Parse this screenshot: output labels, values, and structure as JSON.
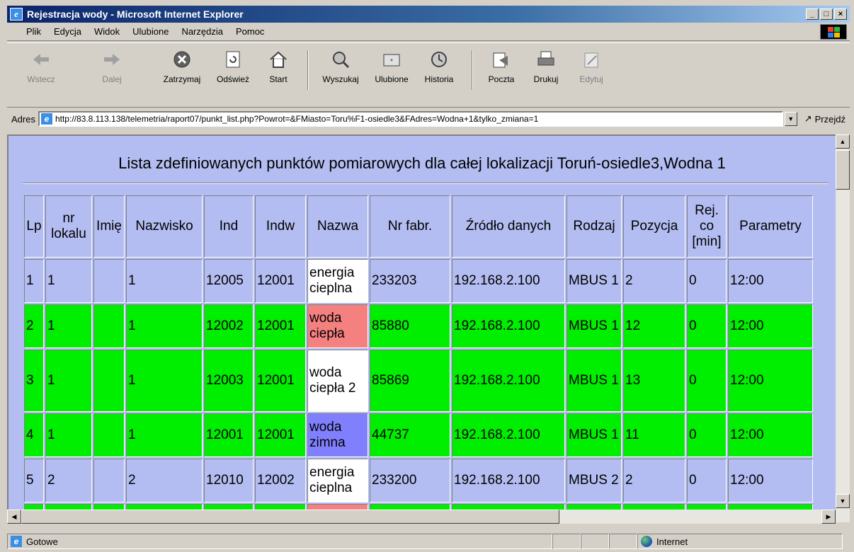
{
  "window": {
    "title": "Rejestracja wody - Microsoft Internet Explorer",
    "min": "_",
    "max": "□",
    "close": "×"
  },
  "menu": [
    "Plik",
    "Edycja",
    "Widok",
    "Ulubione",
    "Narzędzia",
    "Pomoc"
  ],
  "toolbar": {
    "back": "Wstecz",
    "forward": "Dalej",
    "stop": "Zatrzymaj",
    "refresh": "Odśwież",
    "home": "Start",
    "search": "Wyszukaj",
    "favorites": "Ulubione",
    "history": "Historia",
    "mail": "Poczta",
    "print": "Drukuj",
    "edit": "Edytuj"
  },
  "address": {
    "label": "Adres",
    "url": "http://83.8.113.138/telemetria/raport07/punkt_list.php?Powrot=&FMiasto=Toru%F1-osiedle3&FAdres=Wodna+1&tylko_zmiana=1",
    "go": "Przejdź"
  },
  "page": {
    "heading": "Lista zdefiniowanych punktów pomiarowych dla całej lokalizacji Toruń-osiedle3,Wodna 1",
    "headers": [
      "Lp",
      "nr lokalu",
      "Imię",
      "Nazwisko",
      "Ind",
      "Indw",
      "Nazwa",
      "Nr fabr.",
      "Źródło danych",
      "Rodzaj",
      "Pozycja",
      "Rej. co [min]",
      "Parametry"
    ],
    "rows": [
      {
        "lp": "1",
        "lokal": "1",
        "imie": "",
        "nazwisko": "1",
        "ind": "12005",
        "indw": "12001",
        "nazwa": "energia cieplna",
        "nrfabr": "233203",
        "zrodlo": "192.168.2.100",
        "rodzaj": "MBUS 1",
        "pozycja": "2",
        "rej": "0",
        "param": "12:00"
      },
      {
        "lp": "2",
        "lokal": "1",
        "imie": "",
        "nazwisko": "1",
        "ind": "12002",
        "indw": "12001",
        "nazwa": "woda ciepła",
        "nrfabr": "85880",
        "zrodlo": "192.168.2.100",
        "rodzaj": "MBUS 1",
        "pozycja": "12",
        "rej": "0",
        "param": "12:00"
      },
      {
        "lp": "3",
        "lokal": "1",
        "imie": "",
        "nazwisko": "1",
        "ind": "12003",
        "indw": "12001",
        "nazwa": "woda ciepła 2",
        "nrfabr": "85869",
        "zrodlo": "192.168.2.100",
        "rodzaj": "MBUS 1",
        "pozycja": "13",
        "rej": "0",
        "param": "12:00"
      },
      {
        "lp": "4",
        "lokal": "1",
        "imie": "",
        "nazwisko": "1",
        "ind": "12001",
        "indw": "12001",
        "nazwa": "woda zimna",
        "nrfabr": "44737",
        "zrodlo": "192.168.2.100",
        "rodzaj": "MBUS 1",
        "pozycja": "11",
        "rej": "0",
        "param": "12:00"
      },
      {
        "lp": "5",
        "lokal": "2",
        "imie": "",
        "nazwisko": "2",
        "ind": "12010",
        "indw": "12002",
        "nazwa": "energia cieplna",
        "nrfabr": "233200",
        "zrodlo": "192.168.2.100",
        "rodzaj": "MBUS 2",
        "pozycja": "2",
        "rej": "0",
        "param": "12:00"
      }
    ]
  },
  "status": {
    "left": "Gotowe",
    "zone": "Internet"
  }
}
